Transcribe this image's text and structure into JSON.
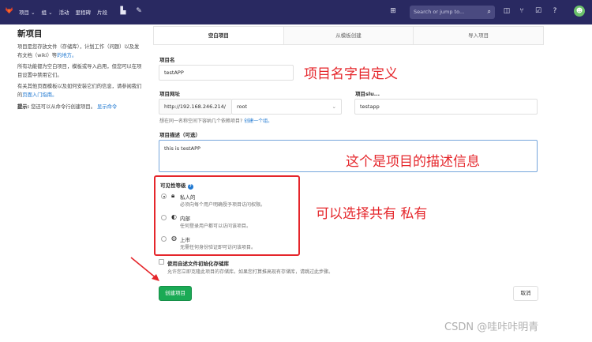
{
  "navbar": {
    "items": [
      "项目 ⌄",
      "组 ⌄",
      "活动",
      "里程碑",
      "片段"
    ],
    "search_placeholder": "Search or jump to...",
    "avatar_icon": "avatar"
  },
  "left": {
    "title": "新项目",
    "p1_text": "项目是您存放文件（存储库），计划工作（问题）以及发布文档（wiki）等",
    "p1_link": "的地方。",
    "p2": "所有功能都为空白项目，模板或导入启用，但您可以在项目设置中禁用它们。",
    "p3_text": "有关其他页面模板以及如何安装它们的信息，请参阅我们的",
    "p3_link": "页面入门指南。",
    "tip_label": "提示:",
    "tip_text": "您还可以从命令行创建项目。",
    "tip_link": "显示命令"
  },
  "tabs": [
    {
      "label": "空白项目",
      "active": true
    },
    {
      "label": "从模板创建",
      "active": false
    },
    {
      "label": "导入项目",
      "active": false
    }
  ],
  "form": {
    "name_label": "项目名",
    "name_value": "testAPP",
    "url_label": "项目网址",
    "url_prefix": "http://192.168.246.214/",
    "namespace": "root",
    "slug_label": "项目slu...",
    "slug_value": "testapp",
    "namespace_help": "想在同一名称空间下容纳几个依赖项目?",
    "namespace_help_link": "创建一个组。",
    "desc_label": "项目描述（可选）",
    "desc_value": "this is testAPP",
    "visibility_label": "可见性等级",
    "visibility_options": [
      {
        "title": "私人的",
        "desc": "必须向每个用户明确授予项目访问权限。",
        "checked": true,
        "icon": "lock-icon"
      },
      {
        "title": "内部",
        "desc": "任何登录用户都可以访问该项目。",
        "checked": false,
        "icon": "shield-icon"
      },
      {
        "title": "上市",
        "desc": "无需任何身份验证即可访问该项目。",
        "checked": false,
        "icon": "globe-icon"
      }
    ],
    "init_label": "使用自述文件初始化存储库",
    "init_help": "允许您立即克隆此项目的存储库。如果您打算推高现有存储库，请跳过此步骤。",
    "create_button": "创建项目",
    "cancel_button": "取消"
  },
  "annotations": {
    "name_note": "项目名字自定义",
    "desc_note": "这个是项目的描述信息",
    "visibility_note": "可以选择共有  私有"
  },
  "watermark": "CSDN @哇咔咔明青",
  "colors": {
    "navbar": "#292961",
    "accent": "#1aaa55",
    "annotation": "#e5262b",
    "link": "#1f78d1"
  }
}
